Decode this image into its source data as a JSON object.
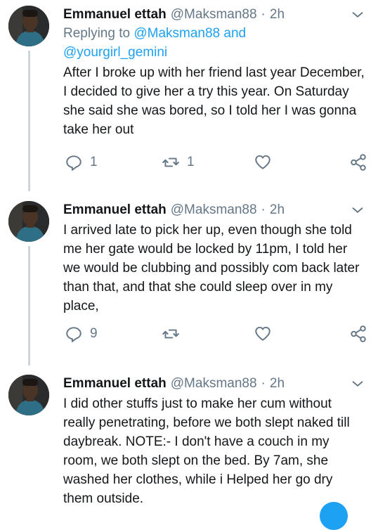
{
  "tweets": [
    {
      "name": "Emmanuel ettah",
      "handle": "@Maksman88",
      "separator": "·",
      "time": "2h",
      "replying_prefix": "Replying to",
      "replying_to_1": "@Maksman88",
      "replying_and": "and",
      "replying_to_2": "@yourgirl_gemini",
      "text": "After I broke up with her friend last year December, I decided to give her a try this year. On Saturday she said she was bored, so I told her I was gonna take her out",
      "reply_count": "1",
      "retweet_count": "1",
      "like_count": ""
    },
    {
      "name": "Emmanuel ettah",
      "handle": "@Maksman88",
      "separator": "·",
      "time": "2h",
      "text": "I arrived late to pick her up, even though she told me her gate would be locked by 11pm, I told her we would be clubbing and possibly com back later than that, and that she could sleep over in my place,",
      "reply_count": "9",
      "retweet_count": "",
      "like_count": ""
    },
    {
      "name": "Emmanuel ettah",
      "handle": "@Maksman88",
      "separator": "·",
      "time": "2h",
      "text": "I did other stuffs just to make her cum without really penetrating, before we both slept naked till daybreak. NOTE:- I don't have a couch in my room, we both slept on the bed. By 7am, she washed her clothes, while i Helped her go dry them outside."
    }
  ],
  "colors": {
    "accent": "#1da1f2",
    "muted": "#657786",
    "text": "#14171a",
    "thread_line": "#ccd6dd"
  },
  "icons": [
    "chevron-down-icon",
    "reply-icon",
    "retweet-icon",
    "like-icon",
    "share-icon",
    "avatar"
  ]
}
